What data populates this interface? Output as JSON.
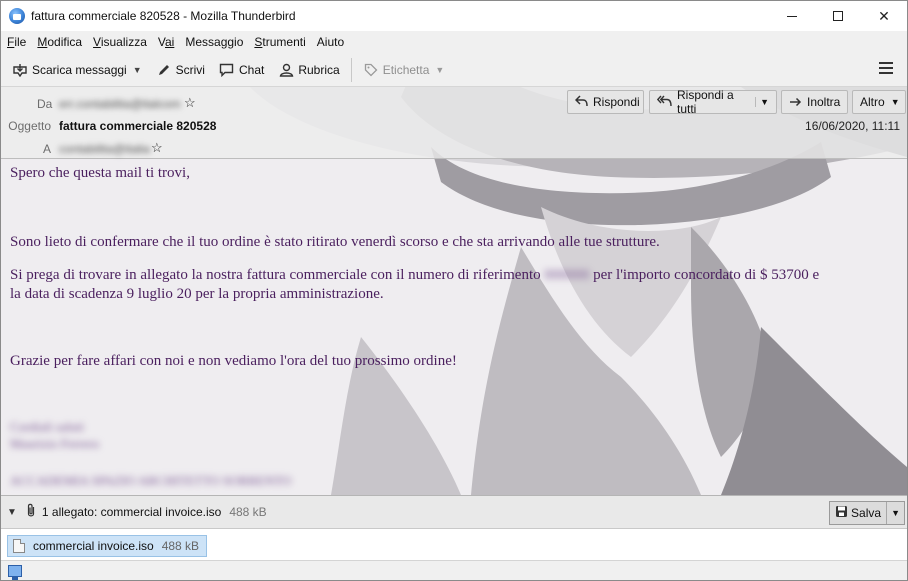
{
  "window": {
    "title": "fattura commerciale 820528 - Mozilla Thunderbird",
    "controls": {
      "minimize": "—",
      "maximize": "☐",
      "close": "✕"
    }
  },
  "menubar": {
    "items": [
      {
        "label": "File",
        "accel": "F",
        "rest": "ile"
      },
      {
        "label": "Modifica",
        "accel": "M",
        "rest": "odifica"
      },
      {
        "label": "Visualizza",
        "accel": "V",
        "rest": "isualizza"
      },
      {
        "label": "Vai",
        "accel": "V",
        "rest": "ai"
      },
      {
        "label": "Messaggio",
        "accel": "M",
        "rest": "essaggio"
      },
      {
        "label": "Strumenti",
        "accel": "S",
        "rest": "trumenti"
      },
      {
        "label": "Aiuto",
        "accel": "A",
        "rest": "iuto"
      }
    ]
  },
  "toolbar": {
    "get_messages": "Scarica messaggi",
    "write": "Scrivi",
    "chat": "Chat",
    "address_book": "Rubrica",
    "tag": "Etichetta"
  },
  "header": {
    "from_label": "Da",
    "from_value": "err.contabilita@italcom",
    "subject_label": "Oggetto",
    "subject_value": "fattura commerciale 820528",
    "to_label": "A",
    "to_value": "contabilita@italia",
    "date": "16/06/2020, 11:11",
    "reply": "Rispondi",
    "reply_all": "Rispondi a tutti",
    "forward": "Inoltra",
    "more": "Altro"
  },
  "message": {
    "greeting": "Spero che questa mail ti trovi,",
    "para1": "Sono lieto di confermare che il tuo ordine è stato ritirato venerdì scorso e che sta arrivando alle tue strutture.",
    "para2_a": "Si prega di trovare in allegato la nostra fattura commerciale con il numero di riferimento",
    "para2_ref": "000000",
    "para2_b": "per l'importo concordato di $ 53700 e",
    "para2_line2": "la data di scadenza 9 luglio 20 per la propria amministrazione.",
    "closing": "Grazie per fare affari con noi e non vediamo l'ora del tuo prossimo ordine!",
    "sig1": "Cordiali saluti",
    "sig2": "Maurizio Ferrero",
    "sig3": "ACCADEMIA SPAZIO ARCHITETTO SORRENTO"
  },
  "attachments": {
    "summary": "1 allegato: commercial invoice.iso",
    "summary_size": "488 kB",
    "save": "Salva",
    "items": [
      {
        "name": "commercial invoice.iso",
        "size": "488 kB"
      }
    ]
  },
  "colors": {
    "body_text": "#4a1f5e",
    "attachment_selected": "#cde3f7"
  }
}
